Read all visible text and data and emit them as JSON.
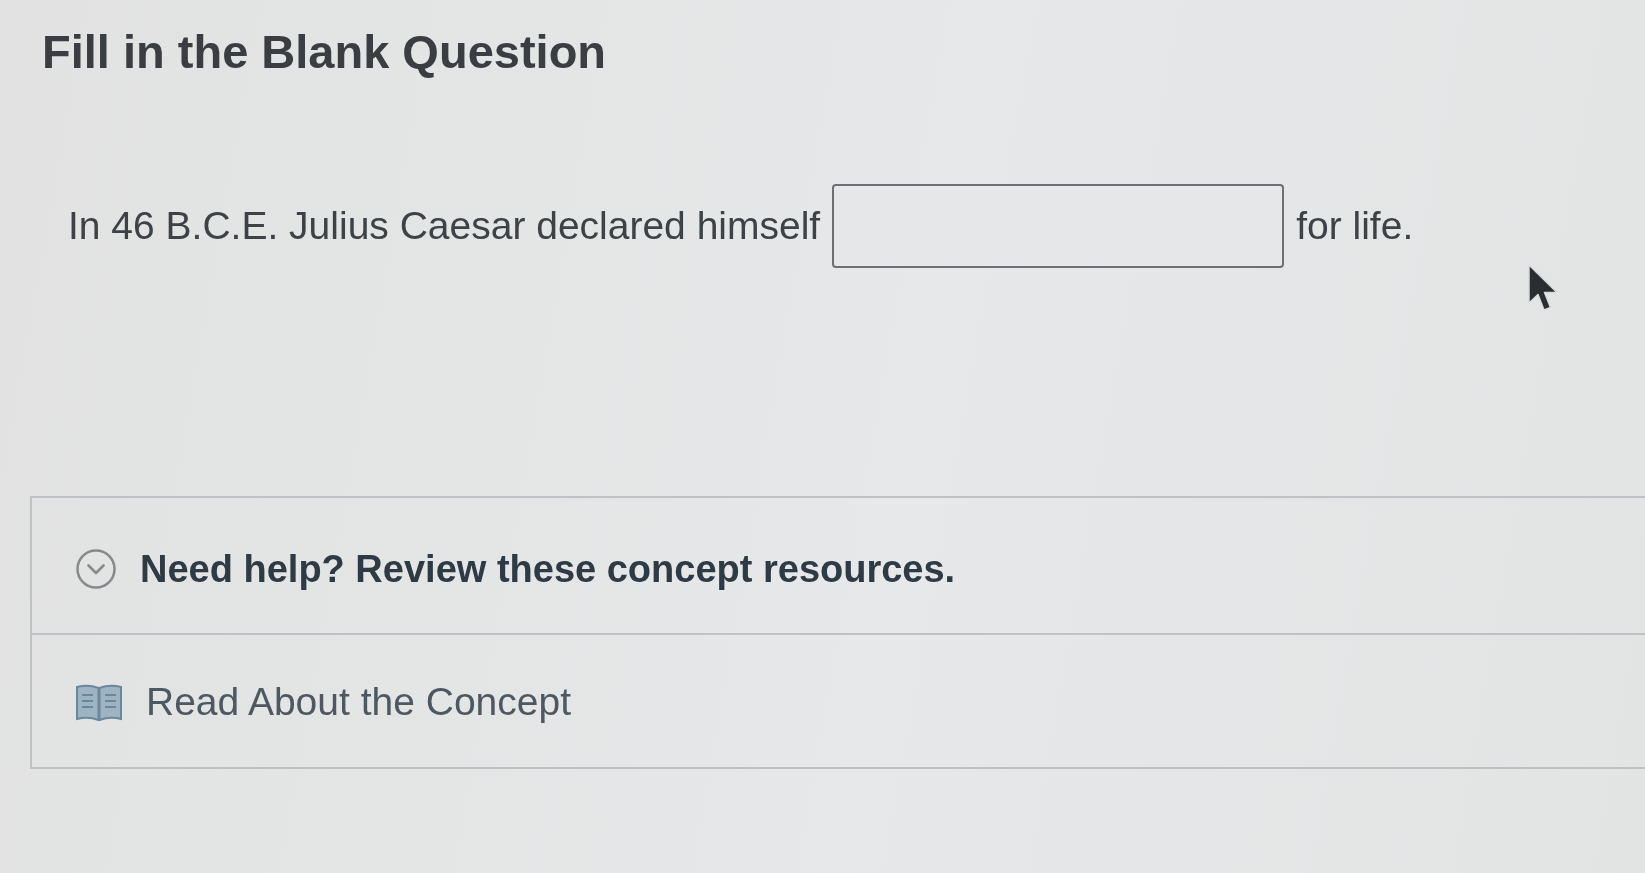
{
  "question": {
    "title": "Fill in the Blank Question",
    "segments": [
      {
        "kind": "text",
        "text": "In 46 B.C.E. Julius Caesar declared himself"
      },
      {
        "kind": "blank"
      },
      {
        "kind": "text",
        "text": "for life."
      }
    ]
  },
  "help": {
    "title": "Need help? Review these concept resources.",
    "expanded": true,
    "resources": [
      {
        "label": "Read About the Concept"
      }
    ]
  }
}
